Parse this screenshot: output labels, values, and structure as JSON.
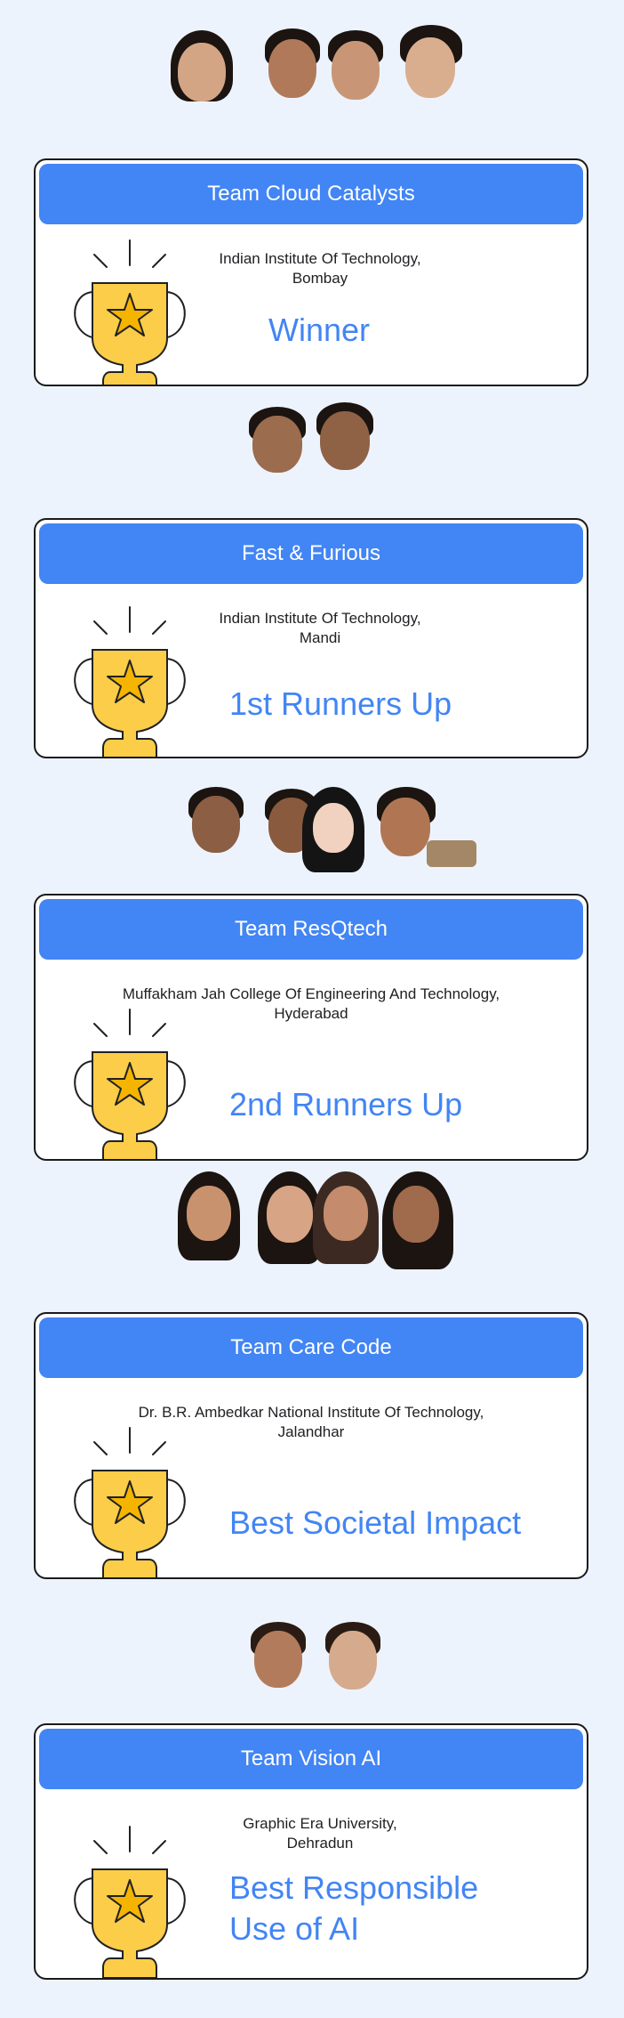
{
  "teams": [
    {
      "name": "Team Cloud Catalysts",
      "college_line1": "Indian Institute Of Technology,",
      "college_line2": "Bombay",
      "award_line1": "Winner",
      "award_line2": ""
    },
    {
      "name": "Fast & Furious",
      "college_line1": "Indian Institute Of Technology,",
      "college_line2": "Mandi",
      "award_line1": "1st Runners Up",
      "award_line2": ""
    },
    {
      "name": "Team ResQtech",
      "college_line1": "Muffakham Jah College Of Engineering And Technology,",
      "college_line2": "Hyderabad",
      "award_line1": "2nd Runners Up",
      "award_line2": ""
    },
    {
      "name": "Team Care Code",
      "college_line1": "Dr. B.R. Ambedkar National Institute Of Technology,",
      "college_line2": "Jalandhar",
      "award_line1": "Best Societal Impact",
      "award_line2": ""
    },
    {
      "name": "Team Vision AI",
      "college_line1": "Graphic Era University,",
      "college_line2": "Dehradun",
      "award_line1": "Best Responsible",
      "award_line2": "Use of AI"
    }
  ],
  "colors": {
    "background": "#edf3fd",
    "banner": "#4285f4",
    "award_text": "#4285f4",
    "trophy": "#fbcd48"
  }
}
